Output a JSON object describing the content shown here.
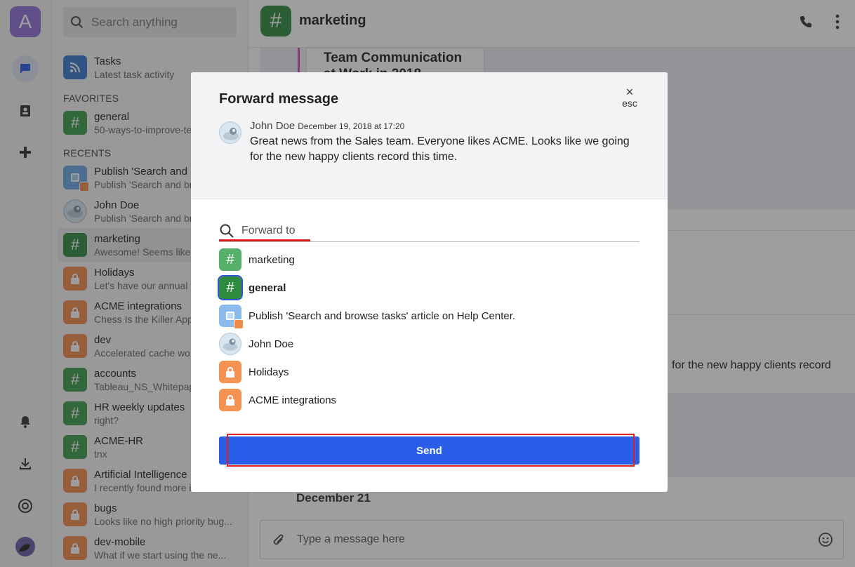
{
  "rail": {
    "avatar_letter": "A"
  },
  "sidebar": {
    "search_placeholder": "Search anything",
    "tasks": {
      "title": "Tasks",
      "preview": "Latest task activity"
    },
    "favorites_header": "FAVORITES",
    "favorites": [
      {
        "title": "general",
        "preview": "50-ways-to-improve-te"
      }
    ],
    "recents_header": "RECENTS",
    "recents": [
      {
        "title": "Publish 'Search and b",
        "preview": "Publish 'Search and br",
        "icon": "task"
      },
      {
        "title": "John Doe",
        "preview": "Publish 'Search and br",
        "icon": "person"
      },
      {
        "title": "marketing",
        "preview": "Awesome! Seems like",
        "icon": "hash",
        "active": true
      },
      {
        "title": "Holidays",
        "preview": "Let's have our annual t",
        "icon": "lock"
      },
      {
        "title": "ACME integrations",
        "preview": "Chess Is the Killer App",
        "icon": "lock"
      },
      {
        "title": "dev",
        "preview": "Accelerated cache wo",
        "icon": "lock"
      },
      {
        "title": "accounts",
        "preview": "Tableau_NS_Whitepap",
        "icon": "hash"
      },
      {
        "title": "HR weekly updates",
        "preview": "right?",
        "icon": "hash"
      },
      {
        "title": "ACME-HR",
        "preview": "tnx",
        "icon": "hash"
      },
      {
        "title": "Artificial Intelligence",
        "preview": "I recently found more i",
        "icon": "lock"
      },
      {
        "title": "bugs",
        "preview": "Looks like no high priority bug...",
        "icon": "lock"
      },
      {
        "title": "dev-mobile",
        "preview": "What if we start using the ne...",
        "icon": "lock"
      }
    ]
  },
  "main": {
    "title": "marketing",
    "bg_article_title_1": "Team Communication",
    "bg_article_title_2": "at Work in 2018",
    "bg_message_tail": "for the new happy clients record",
    "date_divider": "December 21",
    "composer_placeholder": "Type a message here"
  },
  "modal": {
    "title": "Forward message",
    "esc_symbol": "×",
    "esc_label": "esc",
    "message": {
      "author": "John Doe",
      "date": "December 19, 2018 at 17:20",
      "text": "Great news from the Sales team. Everyone likes ACME. Looks like we going for the new happy clients record this time."
    },
    "search_placeholder": "Forward to",
    "options": [
      {
        "label": "marketing",
        "icon": "hash-light",
        "bold": false
      },
      {
        "label": "general",
        "icon": "hash-dark",
        "bold": true
      },
      {
        "label": "Publish 'Search and browse tasks' article on Help Center.",
        "icon": "task",
        "bold": false
      },
      {
        "label": "John Doe",
        "icon": "person",
        "bold": false
      },
      {
        "label": "Holidays",
        "icon": "lock",
        "bold": false
      },
      {
        "label": "ACME integrations",
        "icon": "lock",
        "bold": false
      }
    ],
    "send_label": "Send"
  }
}
